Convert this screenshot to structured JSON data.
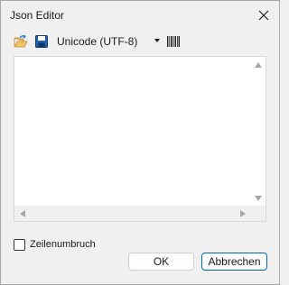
{
  "window": {
    "title": "Json Editor"
  },
  "toolbar": {
    "encoding": "Unicode (UTF-8)",
    "icons": [
      "open-folder-icon",
      "save-icon",
      "barcode-icon"
    ]
  },
  "editor": {
    "content": ""
  },
  "options": {
    "word_wrap_label": "Zeilenumbruch",
    "word_wrap_checked": false
  },
  "buttons": {
    "ok_label": "OK",
    "cancel_label": "Abbrechen"
  },
  "colors": {
    "accent": "#0067c0",
    "background": "#f0f0f0"
  }
}
